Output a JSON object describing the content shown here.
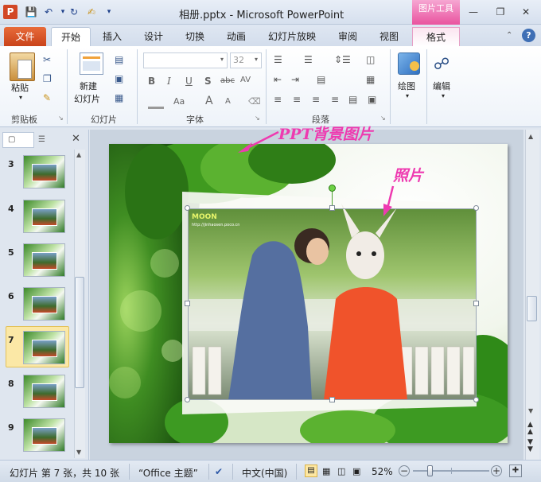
{
  "titlebar": {
    "app_icon": "P",
    "title": "相册.pptx - Microsoft PowerPoint",
    "context_group": "图片工具",
    "icons": [
      "save-icon",
      "undo-icon",
      "redo-icon",
      "format-painter-icon",
      "customize-qat-icon"
    ]
  },
  "tabs": [
    "文件",
    "开始",
    "插入",
    "设计",
    "切换",
    "动画",
    "幻灯片放映",
    "审阅",
    "视图",
    "格式"
  ],
  "ribbon": {
    "clipboard": {
      "paste": "粘贴",
      "label": "剪贴板"
    },
    "slides": {
      "new_slide_line1": "新建",
      "new_slide_line2": "幻灯片",
      "label": "幻灯片"
    },
    "font": {
      "size": "32",
      "label": "字体",
      "bold": "B",
      "italic": "I",
      "underline": "U",
      "shadow": "S",
      "strike": "abc",
      "spacing": "AV",
      "case": "Aa",
      "grow": "A",
      "shrink": "A"
    },
    "paragraph": {
      "label": "段落"
    },
    "drawing": {
      "label": "绘图"
    },
    "editing": {
      "label": "编辑"
    }
  },
  "slide_panel": {
    "slides": [
      {
        "num": "3"
      },
      {
        "num": "4"
      },
      {
        "num": "5"
      },
      {
        "num": "6"
      },
      {
        "num": "7"
      },
      {
        "num": "8"
      },
      {
        "num": "9"
      }
    ],
    "active": "7"
  },
  "slide": {
    "annotation_background": "PPT背景图片",
    "annotation_photo": "照片",
    "watermark": "MOON",
    "watermark_url": "http://jinhaosen.poco.cn"
  },
  "status": {
    "slide_info": "幻灯片 第 7 张，共 10 张",
    "theme": "“Office 主题”",
    "language": "中文(中国)",
    "zoom": "52%",
    "zoom_level": 0.52
  },
  "colors": {
    "accent_pink": "#ee3ab0",
    "file_tab": "#d24726",
    "context_pink": "#e9539f"
  }
}
